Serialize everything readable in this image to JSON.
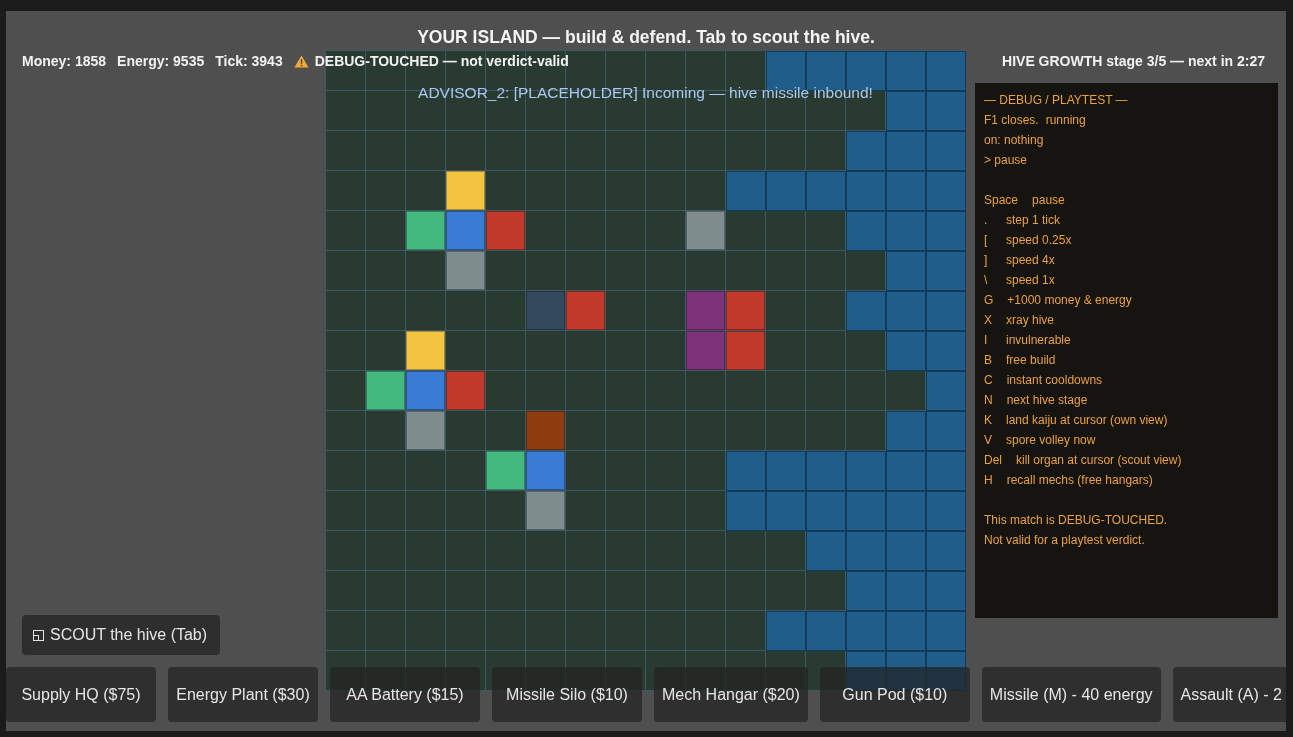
{
  "title": "YOUR ISLAND — build & defend. Tab to scout the hive.",
  "stats": [
    "Money: 1858",
    "Energy: 9535",
    "Tick: 3943"
  ],
  "warning": "DEBUG-TOUCHED — not verdict-valid",
  "hive_status": "HIVE GROWTH stage 3/5 — next in 2:27",
  "advisor_message": "ADVISOR_2: [PLACEHOLDER] Incoming — hive missile inbound!",
  "map": {
    "rows": [
      {
        "cells": [
          {
            "kind": "ground"
          },
          {
            "kind": "ground"
          },
          {
            "kind": "ground"
          },
          {
            "kind": "ground"
          },
          {
            "kind": "ground"
          },
          {
            "kind": "ground"
          },
          {
            "kind": "ground"
          },
          {
            "kind": "ground"
          },
          {
            "kind": "ground"
          },
          {
            "kind": "ground"
          },
          {
            "kind": "ground"
          },
          {
            "kind": "hive"
          },
          {
            "kind": "hive"
          },
          {
            "kind": "hive"
          },
          {
            "kind": "hive"
          },
          {
            "kind": "hive"
          }
        ]
      },
      {
        "cells": [
          {
            "kind": "ground"
          },
          {
            "kind": "ground"
          },
          {
            "kind": "ground"
          },
          {
            "kind": "ground"
          },
          {
            "kind": "ground"
          },
          {
            "kind": "ground"
          },
          {
            "kind": "ground"
          },
          {
            "kind": "ground"
          },
          {
            "kind": "ground"
          },
          {
            "kind": "ground"
          },
          {
            "kind": "ground"
          },
          {
            "kind": "ground"
          },
          {
            "kind": "ground"
          },
          {
            "kind": "ground"
          },
          {
            "kind": "hive"
          },
          {
            "kind": "hive"
          }
        ]
      },
      {
        "cells": [
          {
            "kind": "ground"
          },
          {
            "kind": "ground"
          },
          {
            "kind": "ground"
          },
          {
            "kind": "ground"
          },
          {
            "kind": "ground"
          },
          {
            "kind": "ground"
          },
          {
            "kind": "ground"
          },
          {
            "kind": "ground"
          },
          {
            "kind": "ground"
          },
          {
            "kind": "ground"
          },
          {
            "kind": "ground"
          },
          {
            "kind": "ground"
          },
          {
            "kind": "ground"
          },
          {
            "kind": "hive"
          },
          {
            "kind": "hive"
          },
          {
            "kind": "hive"
          }
        ]
      },
      {
        "cells": [
          {
            "kind": "ground"
          },
          {
            "kind": "ground"
          },
          {
            "kind": "ground"
          },
          {
            "kind": "building",
            "color": "#f4c542"
          },
          {
            "kind": "ground"
          },
          {
            "kind": "ground"
          },
          {
            "kind": "ground"
          },
          {
            "kind": "ground"
          },
          {
            "kind": "ground"
          },
          {
            "kind": "ground"
          },
          {
            "kind": "hive"
          },
          {
            "kind": "hive"
          },
          {
            "kind": "hive"
          },
          {
            "kind": "hive"
          },
          {
            "kind": "hive"
          },
          {
            "kind": "hive"
          }
        ]
      },
      {
        "cells": [
          {
            "kind": "ground"
          },
          {
            "kind": "ground"
          },
          {
            "kind": "building",
            "color": "#44b97f"
          },
          {
            "kind": "building",
            "color": "#3a7bd6"
          },
          {
            "kind": "building",
            "color": "#c0392b"
          },
          {
            "kind": "ground"
          },
          {
            "kind": "ground"
          },
          {
            "kind": "ground"
          },
          {
            "kind": "ground"
          },
          {
            "kind": "building",
            "color": "#7f8c8d"
          },
          {
            "kind": "ground"
          },
          {
            "kind": "ground"
          },
          {
            "kind": "ground"
          },
          {
            "kind": "hive"
          },
          {
            "kind": "hive"
          },
          {
            "kind": "hive"
          }
        ]
      },
      {
        "cells": [
          {
            "kind": "ground"
          },
          {
            "kind": "ground"
          },
          {
            "kind": "ground"
          },
          {
            "kind": "building",
            "color": "#7f8c8d"
          },
          {
            "kind": "ground"
          },
          {
            "kind": "ground"
          },
          {
            "kind": "ground"
          },
          {
            "kind": "ground"
          },
          {
            "kind": "ground"
          },
          {
            "kind": "ground"
          },
          {
            "kind": "ground"
          },
          {
            "kind": "ground"
          },
          {
            "kind": "ground"
          },
          {
            "kind": "ground"
          },
          {
            "kind": "hive"
          },
          {
            "kind": "hive"
          }
        ]
      },
      {
        "cells": [
          {
            "kind": "ground"
          },
          {
            "kind": "ground"
          },
          {
            "kind": "ground"
          },
          {
            "kind": "ground"
          },
          {
            "kind": "ground"
          },
          {
            "kind": "building",
            "color": "#34495e"
          },
          {
            "kind": "building",
            "color": "#c0392b"
          },
          {
            "kind": "ground"
          },
          {
            "kind": "ground"
          },
          {
            "kind": "building",
            "color": "#7d3279"
          },
          {
            "kind": "building",
            "color": "#c0392b"
          },
          {
            "kind": "ground"
          },
          {
            "kind": "ground"
          },
          {
            "kind": "hive"
          },
          {
            "kind": "hive"
          },
          {
            "kind": "hive"
          }
        ]
      },
      {
        "cells": [
          {
            "kind": "ground"
          },
          {
            "kind": "ground"
          },
          {
            "kind": "building",
            "color": "#f4c542"
          },
          {
            "kind": "ground"
          },
          {
            "kind": "ground"
          },
          {
            "kind": "ground"
          },
          {
            "kind": "ground"
          },
          {
            "kind": "ground"
          },
          {
            "kind": "ground"
          },
          {
            "kind": "building",
            "color": "#7d3279"
          },
          {
            "kind": "building",
            "color": "#c0392b"
          },
          {
            "kind": "ground"
          },
          {
            "kind": "ground"
          },
          {
            "kind": "ground"
          },
          {
            "kind": "hive"
          },
          {
            "kind": "hive"
          }
        ]
      },
      {
        "cells": [
          {
            "kind": "ground"
          },
          {
            "kind": "building",
            "color": "#44b97f"
          },
          {
            "kind": "building",
            "color": "#3a7bd6"
          },
          {
            "kind": "building",
            "color": "#c0392b"
          },
          {
            "kind": "ground"
          },
          {
            "kind": "ground"
          },
          {
            "kind": "ground"
          },
          {
            "kind": "ground"
          },
          {
            "kind": "ground"
          },
          {
            "kind": "ground"
          },
          {
            "kind": "ground"
          },
          {
            "kind": "ground"
          },
          {
            "kind": "ground"
          },
          {
            "kind": "ground"
          },
          {
            "kind": "ground"
          },
          {
            "kind": "hive"
          }
        ]
      },
      {
        "cells": [
          {
            "kind": "ground"
          },
          {
            "kind": "ground"
          },
          {
            "kind": "building",
            "color": "#7f8c8d"
          },
          {
            "kind": "ground"
          },
          {
            "kind": "ground"
          },
          {
            "kind": "building",
            "color": "#8e3b10"
          },
          {
            "kind": "ground"
          },
          {
            "kind": "ground"
          },
          {
            "kind": "ground"
          },
          {
            "kind": "ground"
          },
          {
            "kind": "ground"
          },
          {
            "kind": "ground"
          },
          {
            "kind": "ground"
          },
          {
            "kind": "ground"
          },
          {
            "kind": "hive"
          },
          {
            "kind": "hive"
          }
        ]
      },
      {
        "cells": [
          {
            "kind": "ground"
          },
          {
            "kind": "ground"
          },
          {
            "kind": "ground"
          },
          {
            "kind": "ground"
          },
          {
            "kind": "building",
            "color": "#44b97f"
          },
          {
            "kind": "building",
            "color": "#3a7bd6"
          },
          {
            "kind": "ground"
          },
          {
            "kind": "ground"
          },
          {
            "kind": "ground"
          },
          {
            "kind": "ground"
          },
          {
            "kind": "hive"
          },
          {
            "kind": "hive"
          },
          {
            "kind": "hive"
          },
          {
            "kind": "hive"
          },
          {
            "kind": "hive"
          },
          {
            "kind": "hive"
          }
        ]
      },
      {
        "cells": [
          {
            "kind": "ground"
          },
          {
            "kind": "ground"
          },
          {
            "kind": "ground"
          },
          {
            "kind": "ground"
          },
          {
            "kind": "ground"
          },
          {
            "kind": "building",
            "color": "#7f8c8d"
          },
          {
            "kind": "ground"
          },
          {
            "kind": "ground"
          },
          {
            "kind": "ground"
          },
          {
            "kind": "ground"
          },
          {
            "kind": "hive"
          },
          {
            "kind": "hive"
          },
          {
            "kind": "hive"
          },
          {
            "kind": "hive"
          },
          {
            "kind": "hive"
          },
          {
            "kind": "hive"
          }
        ]
      },
      {
        "cells": [
          {
            "kind": "ground"
          },
          {
            "kind": "ground"
          },
          {
            "kind": "ground"
          },
          {
            "kind": "ground"
          },
          {
            "kind": "ground"
          },
          {
            "kind": "ground"
          },
          {
            "kind": "ground"
          },
          {
            "kind": "ground"
          },
          {
            "kind": "ground"
          },
          {
            "kind": "ground"
          },
          {
            "kind": "ground"
          },
          {
            "kind": "ground"
          },
          {
            "kind": "hive"
          },
          {
            "kind": "hive"
          },
          {
            "kind": "hive"
          },
          {
            "kind": "hive"
          }
        ]
      },
      {
        "cells": [
          {
            "kind": "ground"
          },
          {
            "kind": "ground"
          },
          {
            "kind": "ground"
          },
          {
            "kind": "ground"
          },
          {
            "kind": "ground"
          },
          {
            "kind": "ground"
          },
          {
            "kind": "ground"
          },
          {
            "kind": "ground"
          },
          {
            "kind": "ground"
          },
          {
            "kind": "ground"
          },
          {
            "kind": "ground"
          },
          {
            "kind": "ground"
          },
          {
            "kind": "ground"
          },
          {
            "kind": "hive"
          },
          {
            "kind": "hive"
          },
          {
            "kind": "hive"
          }
        ]
      },
      {
        "cells": [
          {
            "kind": "ground"
          },
          {
            "kind": "ground"
          },
          {
            "kind": "ground"
          },
          {
            "kind": "ground"
          },
          {
            "kind": "ground"
          },
          {
            "kind": "ground"
          },
          {
            "kind": "ground"
          },
          {
            "kind": "ground"
          },
          {
            "kind": "ground"
          },
          {
            "kind": "ground"
          },
          {
            "kind": "ground"
          },
          {
            "kind": "hive"
          },
          {
            "kind": "hive"
          },
          {
            "kind": "hive"
          },
          {
            "kind": "hive"
          },
          {
            "kind": "hive"
          }
        ]
      },
      {
        "cells": [
          {
            "kind": "ground"
          },
          {
            "kind": "ground"
          },
          {
            "kind": "ground"
          },
          {
            "kind": "ground"
          },
          {
            "kind": "ground"
          },
          {
            "kind": "ground"
          },
          {
            "kind": "ground"
          },
          {
            "kind": "ground"
          },
          {
            "kind": "ground"
          },
          {
            "kind": "ground"
          },
          {
            "kind": "ground"
          },
          {
            "kind": "ground"
          },
          {
            "kind": "ground"
          },
          {
            "kind": "hive"
          },
          {
            "kind": "hive"
          },
          {
            "kind": "hive"
          }
        ]
      }
    ]
  },
  "debug_panel": {
    "title": "— DEBUG / PLAYTEST —",
    "hint": "F1 closes.",
    "status": "running",
    "lines": [
      "on: nothing",
      "> pause"
    ],
    "bindings": [
      {
        "key": "Space",
        "action": "pause"
      },
      {
        "key": ".",
        "action": "step 1 tick"
      },
      {
        "key": "[",
        "action": "speed 0.25x"
      },
      {
        "key": "]",
        "action": "speed 4x"
      },
      {
        "key": "\\",
        "action": "speed 1x"
      },
      {
        "key": "G",
        "action": "+1000 money & energy"
      },
      {
        "key": "X",
        "action": "xray hive"
      },
      {
        "key": "I",
        "action": "invulnerable"
      },
      {
        "key": "B",
        "action": "free build"
      },
      {
        "key": "C",
        "action": "instant cooldowns"
      },
      {
        "key": "N",
        "action": "next hive stage"
      },
      {
        "key": "K",
        "action": "land kaiju at cursor (own view)"
      },
      {
        "key": "V",
        "action": "spore volley now"
      },
      {
        "key": "Del",
        "action": "kill organ at cursor (scout view)"
      },
      {
        "key": "H",
        "action": "recall mechs (free hangars)"
      }
    ],
    "footer": [
      "This match is DEBUG-TOUCHED.",
      "Not valid for a playtest verdict."
    ]
  },
  "scout_button": {
    "label": "SCOUT the hive (Tab)"
  },
  "action_bar": [
    {
      "kind": "build",
      "label": "Supply HQ ($75)"
    },
    {
      "kind": "build",
      "label": "Energy Plant ($30)"
    },
    {
      "kind": "build",
      "label": "AA Battery ($15)"
    },
    {
      "kind": "build",
      "label": "Missile Silo ($10)"
    },
    {
      "kind": "build",
      "label": "Mech Hangar ($20)"
    },
    {
      "kind": "build",
      "label": "Gun Pod ($10)"
    },
    {
      "kind": "ability",
      "label": "Missile (M) - 40 energy"
    },
    {
      "kind": "ability",
      "label": "Assault (A) - 2"
    }
  ]
}
